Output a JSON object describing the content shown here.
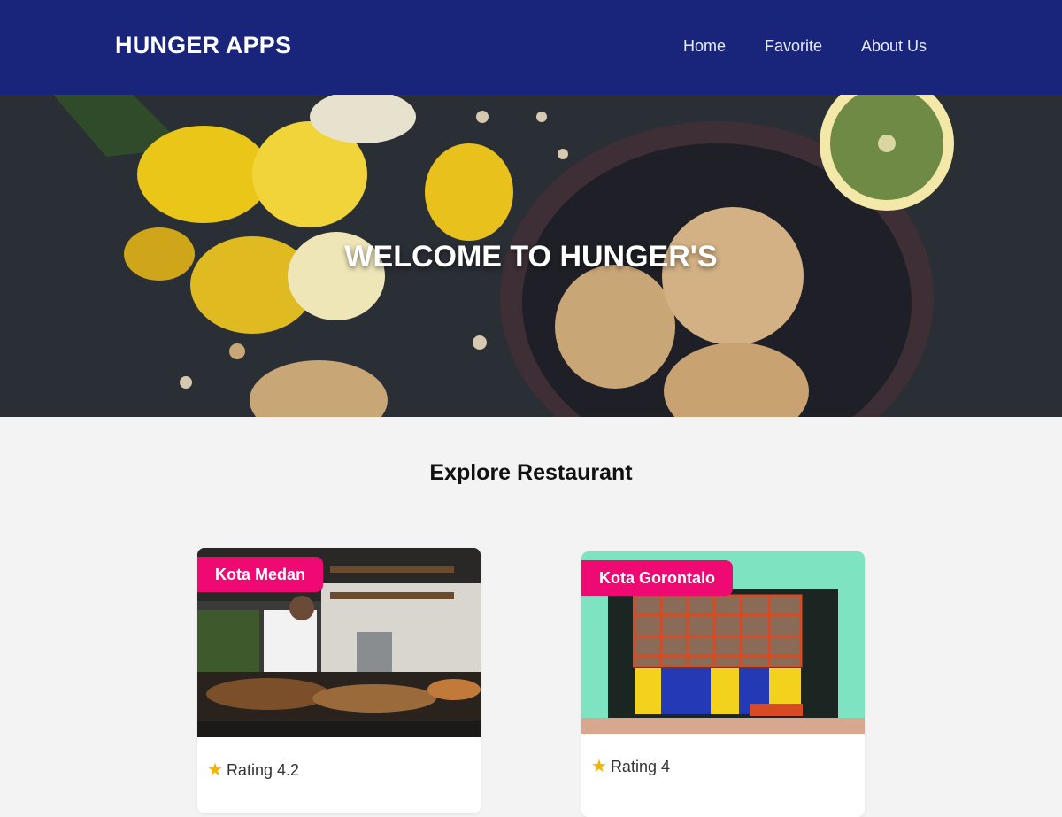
{
  "header": {
    "brand": "HUNGER APPS",
    "nav": [
      {
        "label": "Home"
      },
      {
        "label": "Favorite"
      },
      {
        "label": "About Us"
      }
    ]
  },
  "hero": {
    "title": "WELCOME TO HUNGER'S"
  },
  "main": {
    "section_title": "Explore Restaurant",
    "restaurants": [
      {
        "city": "Kota Medan",
        "rating_text": "Rating 4.2",
        "rating": 4.2
      },
      {
        "city": "Kota Gorontalo",
        "rating_text": "Rating 4",
        "rating": 4
      }
    ]
  },
  "icons": {
    "rating": "star-icon"
  },
  "colors": {
    "header_bg": "#18257a",
    "badge_bg": "#ee0a72",
    "page_bg": "#f3f3f3",
    "star": "#f5b400"
  }
}
